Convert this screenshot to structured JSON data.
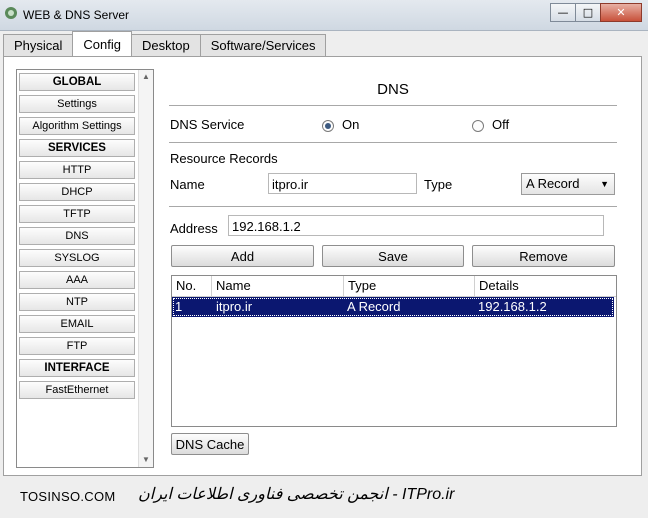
{
  "window": {
    "title": "WEB & DNS Server",
    "controls": [
      "—",
      "□",
      "✕"
    ]
  },
  "tabs": [
    "Physical",
    "Config",
    "Desktop",
    "Software/Services"
  ],
  "active_tab": "Config",
  "sidebar": {
    "items": [
      {
        "label": "GLOBAL",
        "header": true
      },
      {
        "label": "Settings",
        "header": false
      },
      {
        "label": "Algorithm Settings",
        "header": false
      },
      {
        "label": "SERVICES",
        "header": true
      },
      {
        "label": "HTTP",
        "header": false
      },
      {
        "label": "DHCP",
        "header": false
      },
      {
        "label": "TFTP",
        "header": false
      },
      {
        "label": "DNS",
        "header": false
      },
      {
        "label": "SYSLOG",
        "header": false
      },
      {
        "label": "AAA",
        "header": false
      },
      {
        "label": "NTP",
        "header": false
      },
      {
        "label": "EMAIL",
        "header": false
      },
      {
        "label": "FTP",
        "header": false
      },
      {
        "label": "INTERFACE",
        "header": true
      },
      {
        "label": "FastEthernet",
        "header": false
      }
    ]
  },
  "dns": {
    "heading": "DNS",
    "service_label": "DNS Service",
    "on_label": "On",
    "off_label": "Off",
    "service_state": "On",
    "resource_records_label": "Resource Records",
    "name_label": "Name",
    "name_value": "itpro.ir",
    "type_label": "Type",
    "type_value": "A Record",
    "address_label": "Address",
    "address_value": "192.168.1.2",
    "add_label": "Add",
    "save_label": "Save",
    "remove_label": "Remove",
    "table": {
      "headers": [
        "No.",
        "Name",
        "Type",
        "Details"
      ],
      "rows": [
        {
          "no": "1",
          "name": "itpro.ir",
          "type": "A Record",
          "details": "192.168.1.2"
        }
      ]
    },
    "cache_label": "DNS Cache"
  },
  "footer": {
    "left": "TOSINSO.COM",
    "right": "ITPro.ir - انجمن تخصصی فناوری اطلاعات ایران"
  },
  "colors": {
    "selection": "#0b1770",
    "accent": "#3d5a80"
  }
}
